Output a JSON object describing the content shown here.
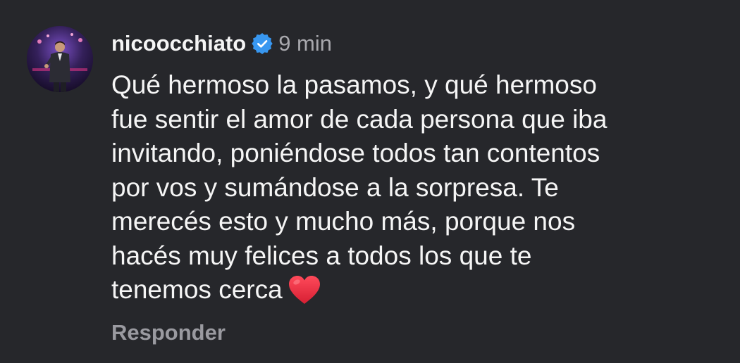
{
  "comment": {
    "username": "nicoocchiato",
    "verified": true,
    "timestamp": "9 min",
    "text_lines": [
      "Qué hermoso la pasamos, y qué hermoso",
      "fue sentir el amor de cada persona que iba",
      "invitando, poniéndose todos tan contentos",
      "por vos y sumándose a la sorpresa. Te",
      "merecés esto y mucho más, porque nos",
      "hacés muy felices a todos los que te",
      "tenemos cerca"
    ],
    "emoji": "heart-icon",
    "reply_label": "Responder"
  },
  "colors": {
    "background": "#26272b",
    "text": "#f5f5f5",
    "muted": "#a8a8ad",
    "verified_badge": "#3897f0",
    "heart": "#e8293b"
  }
}
